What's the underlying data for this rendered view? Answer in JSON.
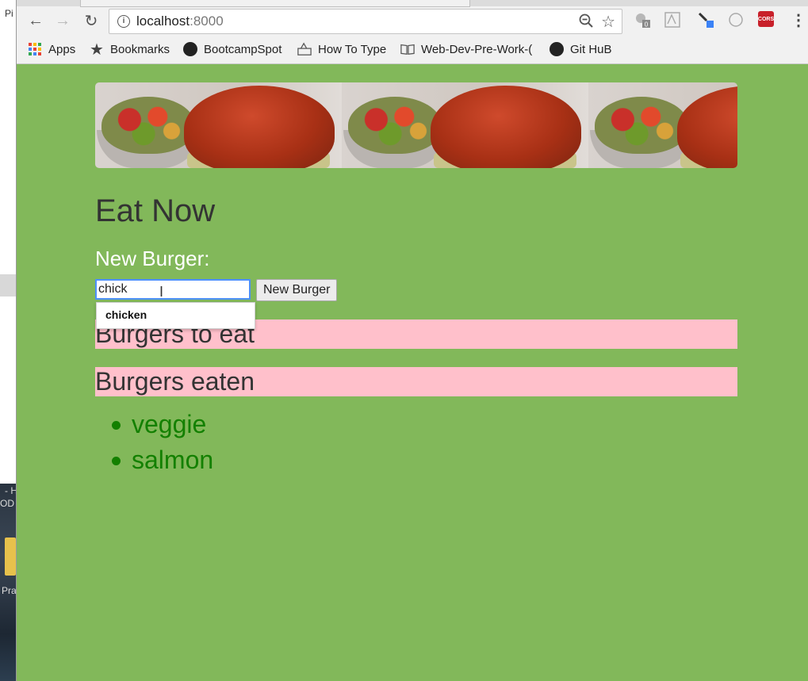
{
  "desktop": {
    "top_label": "Pi",
    "task_label": "- H",
    "task_sub": "OD",
    "folder_label": "Pra"
  },
  "browser": {
    "url_host": "localhost",
    "url_port": ":8000"
  },
  "bookmarks": [
    {
      "label": "Apps",
      "icon": "apps-grid-icon"
    },
    {
      "label": "Bookmarks",
      "icon": "star-icon"
    },
    {
      "label": "BootcampSpot",
      "icon": "github-icon"
    },
    {
      "label": "How To Type",
      "icon": "typing-icon"
    },
    {
      "label": "Web-Dev-Pre-Work-(",
      "icon": "book-icon"
    },
    {
      "label": "Git HuB",
      "icon": "github-icon"
    }
  ],
  "extensions": {
    "badge_count": "0",
    "cors_label": "CORS"
  },
  "page": {
    "title": "Eat Now",
    "new_burger_label": "New Burger:",
    "input_value": "chick",
    "submit_label": "New Burger",
    "autocomplete_suggestion": "chicken",
    "to_eat_heading": "Burgers to eat",
    "eaten_heading": "Burgers eaten",
    "eaten_items": [
      "veggie",
      "salmon"
    ]
  },
  "colors": {
    "page_background": "#82b85a",
    "band_background": "#ffc0cb",
    "eaten_text": "#138000"
  }
}
